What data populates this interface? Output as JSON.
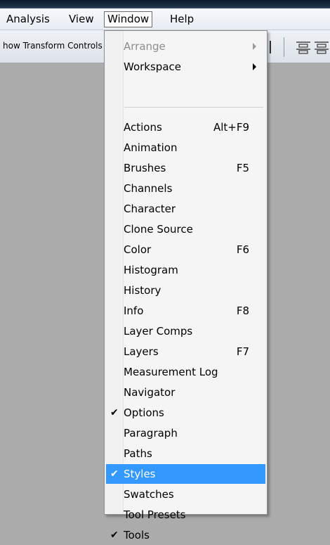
{
  "menubar": {
    "items": [
      {
        "label": "Analysis"
      },
      {
        "label": "View"
      },
      {
        "label": "Window"
      },
      {
        "label": "Help"
      }
    ]
  },
  "options_bar": {
    "show_transform_label": "how Transform Controls"
  },
  "window_menu": {
    "submenu_items": [
      {
        "label": "Arrange",
        "disabled": true
      },
      {
        "label": "Workspace",
        "disabled": false
      }
    ],
    "items": [
      {
        "label": "Actions",
        "shortcut": "Alt+F9"
      },
      {
        "label": "Animation",
        "shortcut": ""
      },
      {
        "label": "Brushes",
        "shortcut": "F5"
      },
      {
        "label": "Channels",
        "shortcut": ""
      },
      {
        "label": "Character",
        "shortcut": ""
      },
      {
        "label": "Clone Source",
        "shortcut": ""
      },
      {
        "label": "Color",
        "shortcut": "F6"
      },
      {
        "label": "Histogram",
        "shortcut": ""
      },
      {
        "label": "History",
        "shortcut": ""
      },
      {
        "label": "Info",
        "shortcut": "F8"
      },
      {
        "label": "Layer Comps",
        "shortcut": ""
      },
      {
        "label": "Layers",
        "shortcut": "F7"
      },
      {
        "label": "Measurement Log",
        "shortcut": ""
      },
      {
        "label": "Navigator",
        "shortcut": ""
      },
      {
        "label": "Options",
        "shortcut": "",
        "checked": true
      },
      {
        "label": "Paragraph",
        "shortcut": ""
      },
      {
        "label": "Paths",
        "shortcut": ""
      },
      {
        "label": "Styles",
        "shortcut": "",
        "checked": true,
        "highlighted": true
      },
      {
        "label": "Swatches",
        "shortcut": ""
      },
      {
        "label": "Tool Presets",
        "shortcut": ""
      },
      {
        "label": "Tools",
        "shortcut": "",
        "checked": true
      }
    ],
    "check_glyph": "✔"
  },
  "colors": {
    "highlight": "#3399ff",
    "workspace": "#ababab",
    "menu_bg": "#f5f5f5"
  }
}
